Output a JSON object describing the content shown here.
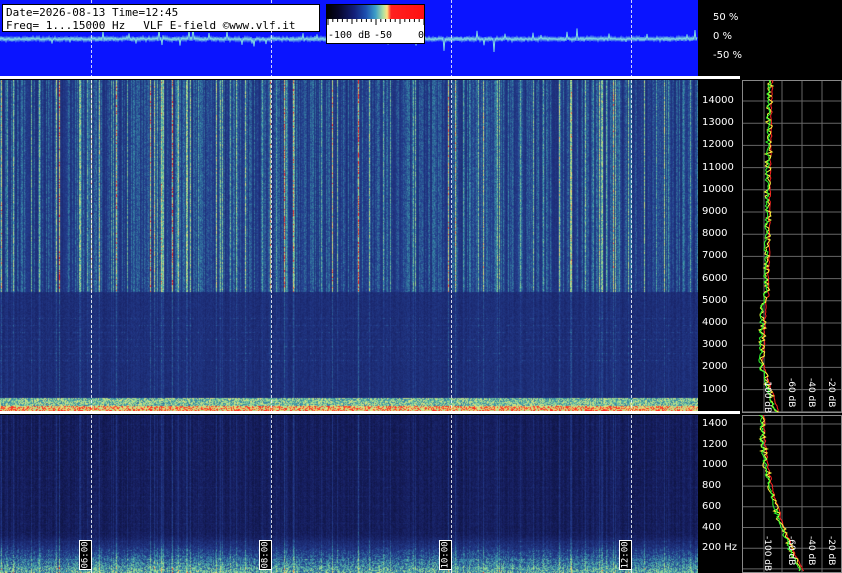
{
  "header": {
    "date_time": "Date=2026-08-13 Time=12:45",
    "freq_range": "Freq= 1...15000 Hz",
    "station": "VLF E-field ©www.vlf.it"
  },
  "color_scale": {
    "labels": [
      "-100 dB",
      "-50",
      "0"
    ],
    "colors": [
      "#000000",
      "#121f78",
      "#3c9ec8",
      "#ffe080",
      "#ff2020"
    ]
  },
  "waveform_axis": [
    "50 %",
    "0 %",
    "-50 %"
  ],
  "time_markers": [
    "06:00",
    "08:00",
    "10:00",
    "12:00"
  ],
  "freq_axis_main": [
    "14000",
    "13000",
    "12000",
    "11000",
    "10000",
    "9000",
    "8000",
    "7000",
    "6000",
    "5000",
    "4000",
    "3000",
    "2000",
    "1000"
  ],
  "freq_axis_low": [
    "1400",
    "1200",
    "1000",
    "800",
    "600",
    "400",
    "200 Hz"
  ],
  "profile_db_main": [
    "-100 dB",
    "-60 dB",
    "-40 dB",
    "-20 dB"
  ],
  "profile_db_low": [
    "-100 dB",
    "-60 dB",
    "-40 dB",
    "-20 dB"
  ],
  "colors": {
    "strip_bg": "#0a14ff",
    "spec_bg": "#1b2470",
    "trace_red": "#ff2020",
    "trace_green": "#30ff30",
    "trace_yellow": "#ffff40"
  }
}
